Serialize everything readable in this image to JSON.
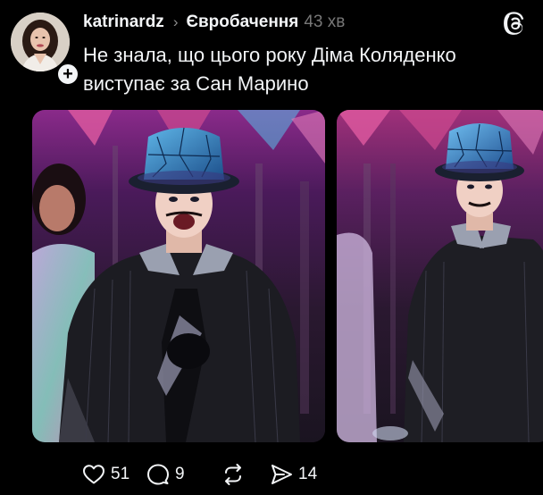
{
  "post": {
    "username": "katrinardz",
    "separator": "›",
    "community": "Євробачення",
    "time": "43 хв",
    "caption_lines": [
      "Не знала, що цього року Діма Коляденко",
      "виступає за Сан Марино"
    ],
    "follow_symbol": "+",
    "images": [
      {
        "name": "performer-closeup"
      },
      {
        "name": "performer-wide"
      }
    ]
  },
  "actions": {
    "likes": "51",
    "replies": "9",
    "reposts": "",
    "shares": "14"
  },
  "icons": {
    "logo": "threads-logo",
    "like": "heart-icon",
    "reply": "comment-icon",
    "repost": "repost-icon",
    "share": "share-icon"
  },
  "colors": {
    "background": "#000000",
    "text": "#f3f5f7",
    "muted": "#777777"
  }
}
